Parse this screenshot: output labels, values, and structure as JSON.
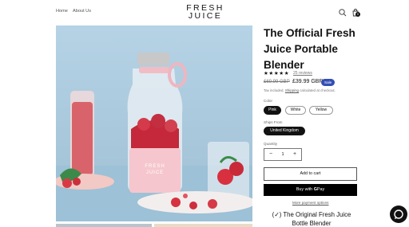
{
  "header": {
    "nav": [
      {
        "label": "Home"
      },
      {
        "label": "About Us"
      }
    ],
    "logo_line1": "FRESH",
    "logo_line2": "JUICE",
    "cart_count": "0"
  },
  "product": {
    "title": "The Official Fresh Juice Portable Blender",
    "stars": "★★★★★",
    "reviews": "25 reviews",
    "price_regular": "£69.99 GBP",
    "price_sale": "£39.99 GBP",
    "sale_badge": "Sale",
    "tax_prefix": "Tax included.",
    "tax_link": "Shipping",
    "tax_suffix": "calculated at checkout.",
    "color_label": "Color",
    "colors": [
      "Pink",
      "White",
      "Yellow"
    ],
    "style_label": "Ships From",
    "style_options": [
      "United Kingdom"
    ],
    "quantity_label": "Quantity",
    "quantity_value": "1",
    "add_to_cart": "Add to cart",
    "gpay_prefix": "Buy with",
    "gpay_g": "G",
    "gpay_suffix": "Pay",
    "more_payment": "More payment options",
    "subheading_line1": "(✓) The Original Fresh Juice",
    "subheading_line2": "Bottle Blender"
  },
  "colors": {
    "sale_badge": "#334fb4",
    "button_dark": "#000000",
    "product_bg": "#a9c8dc"
  }
}
